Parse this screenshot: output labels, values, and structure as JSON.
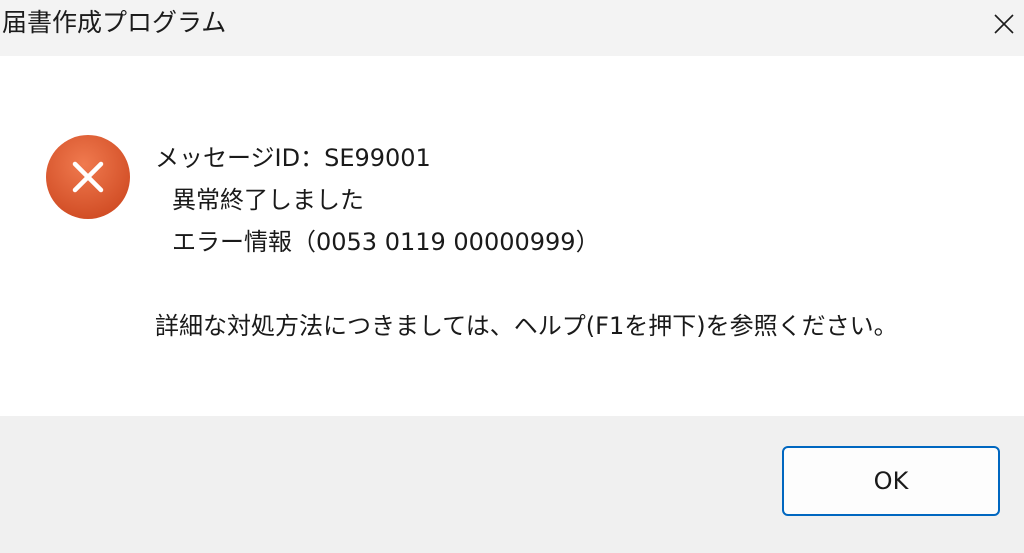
{
  "window": {
    "title": "届書作成プログラム",
    "close_icon": "close-icon"
  },
  "message": {
    "icon": "error-icon",
    "id_line": "メッセージID：SE99001",
    "status_line": "異常終了しました",
    "error_info_line": "エラー情報（0053 0119 00000999）",
    "help_line": "詳細な対処方法につきましては、ヘルプ(F1を押下)を参照ください。"
  },
  "buttons": {
    "ok_label": "OK"
  },
  "colors": {
    "error_red": "#e0562f",
    "accent": "#0067c0"
  }
}
